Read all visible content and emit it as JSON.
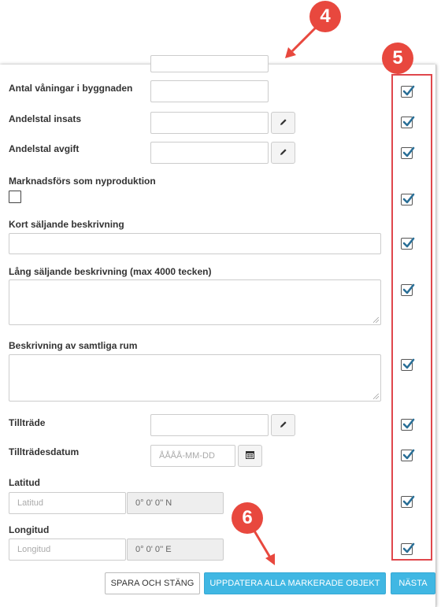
{
  "form": {
    "fields": {
      "floors": {
        "label": "Antal våningar i byggnaden",
        "value": ""
      },
      "andelstal_insats": {
        "label": "Andelstal insats",
        "value": ""
      },
      "andelstal_avgift": {
        "label": "Andelstal avgift",
        "value": ""
      },
      "nyproduktion": {
        "label": "Marknadsförs som nyproduktion",
        "checked": false
      },
      "kort_beskrivning": {
        "label": "Kort säljande beskrivning",
        "value": ""
      },
      "lang_beskrivning": {
        "label": "Lång säljande beskrivning (max 4000 tecken)",
        "value": ""
      },
      "rum_beskrivning": {
        "label": "Beskrivning av samtliga rum",
        "value": ""
      },
      "tilltrade": {
        "label": "Tillträde",
        "value": ""
      },
      "tilltradesdatum": {
        "label": "Tillträdesdatum",
        "placeholder": "ÅÅÅÅ-MM-DD"
      },
      "latitud": {
        "label": "Latitud",
        "placeholder": "Latitud",
        "dms": "0° 0' 0'' N"
      },
      "longitud": {
        "label": "Longitud",
        "placeholder": "Longitud",
        "dms": "0° 0' 0'' E"
      }
    },
    "update_checkboxes": [
      true,
      true,
      true,
      true,
      true,
      true,
      true,
      true,
      true,
      true,
      true
    ]
  },
  "annotations": {
    "step4": "4",
    "step5": "5",
    "step6": "6"
  },
  "buttons": {
    "save_close": "SPARA OCH STÄNG",
    "update_all": "UPPDATERA ALLA MARKERADE OBJEKT",
    "next": "NÄSTA"
  },
  "colors": {
    "primary": "#40b7e3",
    "annotation": "#e8483e",
    "highlight_border": "#e0474c"
  }
}
